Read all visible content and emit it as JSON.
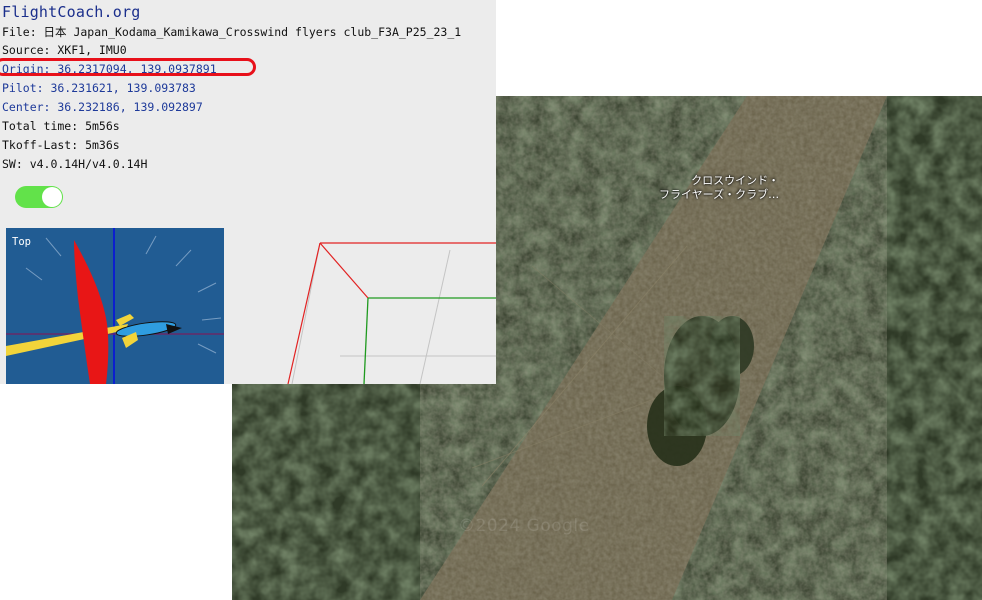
{
  "panel": {
    "site_title": "FlightCoach.org",
    "file_line": "File: 日本 Japan_Kodama_Kamikawa_Crosswind flyers club_F3A_P25_23_1",
    "source_line": "Source: XKF1, IMU0",
    "origin_line": "Origin: 36.2317094, 139.0937891",
    "pilot_line": "Pilot: 36.231621, 139.093783",
    "center_line": "Center: 36.232186, 139.092897",
    "total_time_line": "Total time: 5m56s",
    "tkoff_line": "Tkoff-Last: 5m36s",
    "sw_line": "SW: v4.0.14H/v4.0.14H",
    "toggle_state": "on",
    "topview_label": "Top"
  },
  "map": {
    "place_label_line1": "クロスウインド・",
    "place_label_line2": "フライヤーズ・クラブ…",
    "watermark": "©2024 Google"
  },
  "colors": {
    "title_blue": "#1b2f8c",
    "coord_blue": "#1e3a9a",
    "highlight_red": "#e8101a",
    "toggle_green": "#62e24a",
    "topview_bg": "#215c93",
    "pin_red": "#e8333b"
  }
}
